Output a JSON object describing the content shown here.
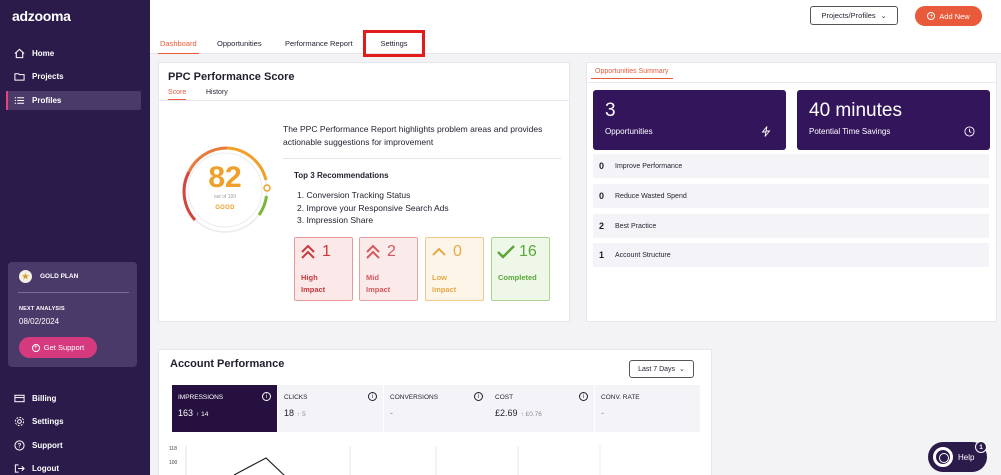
{
  "app": {
    "logo": "adzooma",
    "accent_color": "#e85a3a",
    "sidebar_color": "#2a1b4a"
  },
  "sidebar": {
    "items": [
      {
        "label": "Home",
        "icon": "home-icon"
      },
      {
        "label": "Projects",
        "icon": "folder-icon"
      },
      {
        "label": "Profiles",
        "icon": "list-icon",
        "active": true
      }
    ],
    "plan": {
      "name": "GOLD PLAN",
      "next_label": "NEXT ANALYSIS",
      "next_date": "08/02/2024",
      "support_label": "Get Support"
    },
    "bottom_items": [
      {
        "label": "Billing",
        "icon": "billing-icon"
      },
      {
        "label": "Settings",
        "icon": "gear-icon"
      },
      {
        "label": "Support",
        "icon": "help-circle-icon"
      },
      {
        "label": "Logout",
        "icon": "logout-icon"
      }
    ]
  },
  "topbar": {
    "projects_select": "Projects/Profiles",
    "add_new": "Add New"
  },
  "tabs": [
    {
      "label": "Dashboard",
      "active": true
    },
    {
      "label": "Opportunities"
    },
    {
      "label": "Performance Report"
    },
    {
      "label": "Settings",
      "highlighted": true
    }
  ],
  "ppc": {
    "title": "PPC Performance Score",
    "tabs": [
      "Score",
      "History"
    ],
    "score": "82",
    "score_value": 82,
    "score_max": 100,
    "out_of": "out of 100",
    "grade": "GOOD",
    "description": "The PPC Performance Report highlights problem areas and provides actionable suggestions for improvement",
    "recs_title": "Top 3 Recommendations",
    "recommendations": [
      "1. Conversion Tracking Status",
      "2. Improve your Responsive Search Ads",
      "3. Impression Share"
    ],
    "tiles": [
      {
        "count": "1",
        "label": "High\nImpact"
      },
      {
        "count": "2",
        "label": "Mid\nImpact"
      },
      {
        "count": "0",
        "label": "Low\nImpact"
      },
      {
        "count": "16",
        "label": "Completed"
      }
    ]
  },
  "opportunities": {
    "tab": "Opportunities Summary",
    "count": "3",
    "count_label": "Opportunities",
    "time": "40 minutes",
    "time_label": "Potential Time Savings",
    "rows": [
      {
        "n": "0",
        "label": "Improve Performance"
      },
      {
        "n": "0",
        "label": "Reduce Wasted Spend"
      },
      {
        "n": "2",
        "label": "Best Practice"
      },
      {
        "n": "1",
        "label": "Account Structure"
      }
    ]
  },
  "account": {
    "title": "Account Performance",
    "range": "Last 7 Days",
    "metrics": [
      {
        "label": "IMPRESSIONS",
        "value": "163",
        "delta": "↑ 14",
        "active": true
      },
      {
        "label": "CLICKS",
        "value": "18",
        "delta": "↑ 5"
      },
      {
        "label": "CONVERSIONS",
        "value": "-",
        "delta": ""
      },
      {
        "label": "COST",
        "value": "£2.69",
        "delta": "↑ £0.76"
      },
      {
        "label": "CONV. RATE",
        "value": "-",
        "delta": ""
      }
    ],
    "y_ticks": [
      "118",
      "100"
    ]
  },
  "help": {
    "label": "Help",
    "badge": "1"
  }
}
